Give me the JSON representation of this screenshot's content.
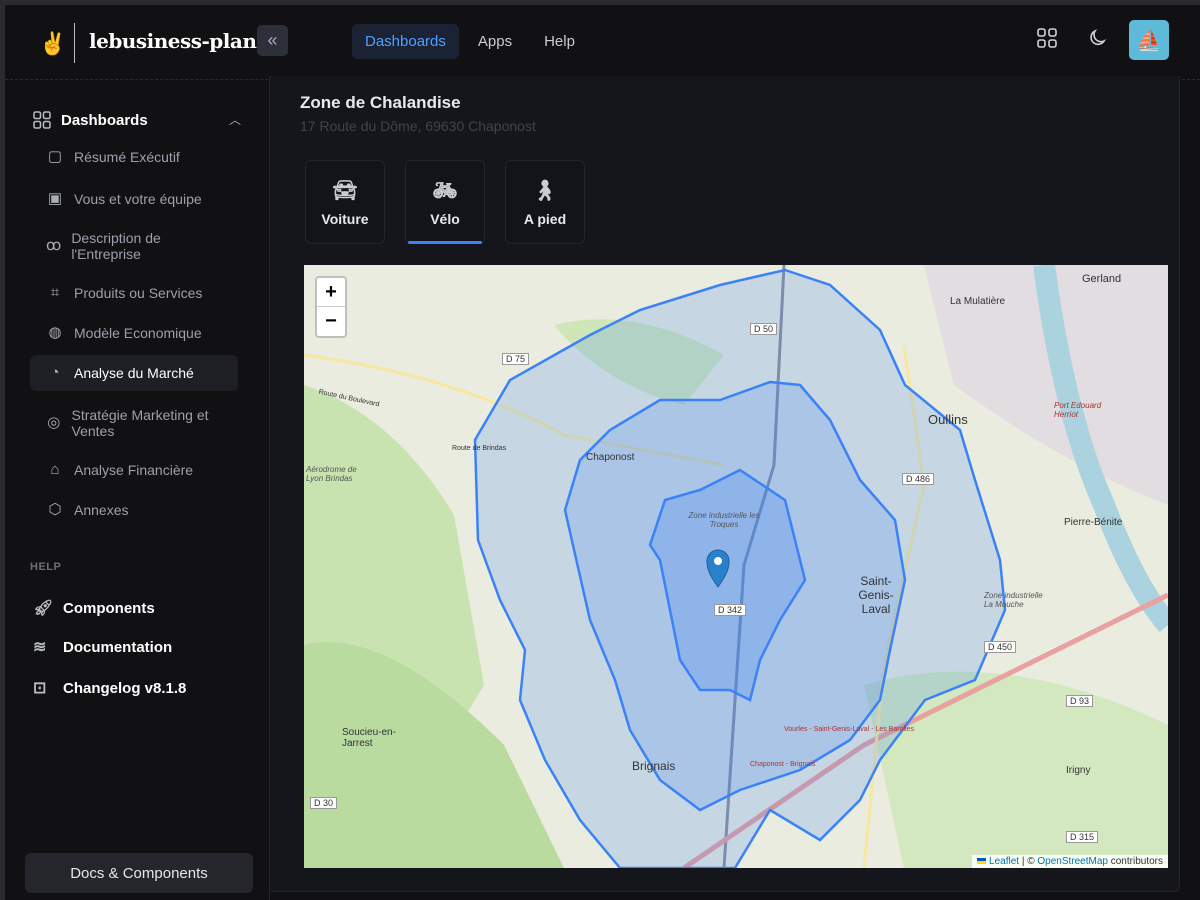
{
  "app": {
    "name": "lebusiness-plan",
    "collapse_icon": "chevrons-left-icon"
  },
  "topnav": [
    {
      "label": "Dashboards",
      "active": true
    },
    {
      "label": "Apps"
    },
    {
      "label": "Help"
    }
  ],
  "sidebar": {
    "section": "Dashboards",
    "items": [
      {
        "label": "Résumé Exécutif",
        "icon": "file-icon"
      },
      {
        "label": "Vous et votre équipe",
        "icon": "contact-icon"
      },
      {
        "label": "Description de l'Entreprise",
        "icon": "circles-icon"
      },
      {
        "label": "Produits ou Services",
        "icon": "box-icon"
      },
      {
        "label": "Modèle Economique",
        "icon": "fingerprint-icon"
      },
      {
        "label": "Analyse du Marché",
        "icon": "chart-pie-icon",
        "active": true
      },
      {
        "label": "Stratégie Marketing et Ventes",
        "icon": "target-icon"
      },
      {
        "label": "Analyse Financière",
        "icon": "bank-icon"
      },
      {
        "label": "Annexes",
        "icon": "hexagon-icon"
      }
    ],
    "help_label": "HELP",
    "help_items": [
      {
        "label": "Components",
        "icon": "rocket-icon"
      },
      {
        "label": "Documentation",
        "icon": "layers-icon"
      },
      {
        "label": "Changelog v8.1.8",
        "icon": "code-icon"
      }
    ],
    "docs_button": "Docs & Components"
  },
  "page": {
    "title": "Zone de Chalandise",
    "address": "17 Route du Dôme, 69630 Chaponost",
    "modes": [
      {
        "label": "Voiture",
        "icon": "car-icon"
      },
      {
        "label": "Vélo",
        "icon": "bike-icon",
        "active": true
      },
      {
        "label": "A pied",
        "icon": "walk-icon"
      }
    ]
  },
  "map": {
    "zoom_in": "+",
    "zoom_out": "−",
    "attribution": {
      "leaflet": "Leaflet",
      "sep": " | © ",
      "osm": "OpenStreetMap",
      "suffix": " contributors"
    },
    "isochrone_color": "#3b82f6",
    "places": [
      "Gerland",
      "La Mulatière",
      "Oullins",
      "Chaponost",
      "Pierre-Bénite",
      "Saint-Genis-Laval",
      "Brignais",
      "Irigny",
      "Soucieu-en-Jarrest",
      "Zone industrielle les Troques",
      "Zone industrielle La Mouche",
      "Aérodrome de Lyon Brindas",
      "Port Edouard Herriot",
      "Route du Boulevard",
      "Route de Brindas",
      "Chaponost - Brignais",
      "Vourles - Saint-Genis-Laval - Les Barolles"
    ],
    "roads": [
      "D 75",
      "D 50",
      "D 486",
      "D 342",
      "D 450",
      "D 93",
      "D 30",
      "D 315"
    ]
  }
}
